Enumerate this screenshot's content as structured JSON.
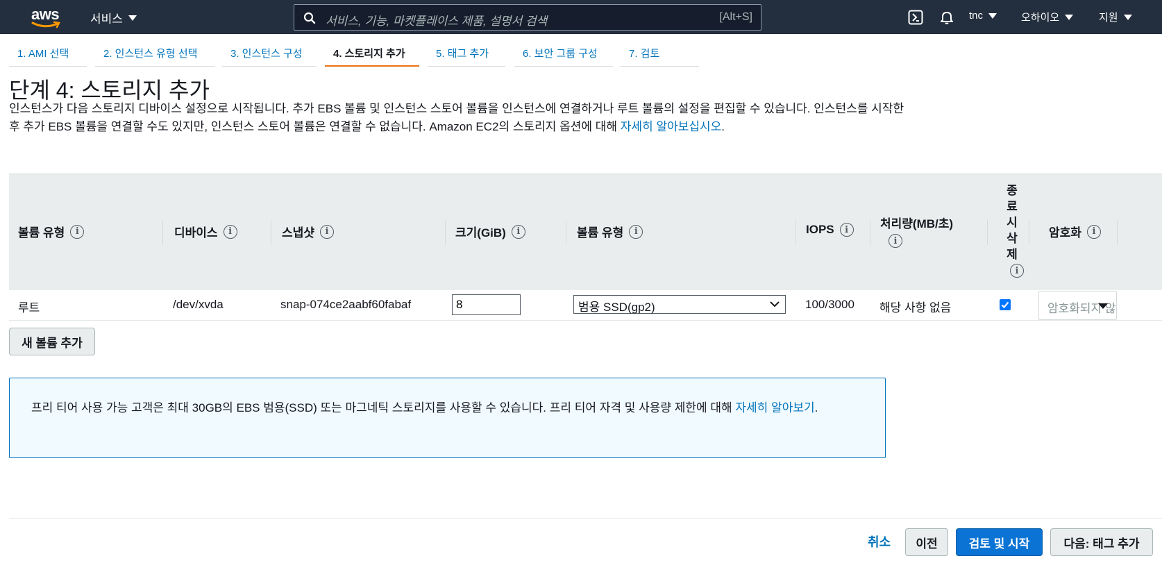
{
  "topnav": {
    "logo_text": "aws",
    "services_label": "서비스",
    "search_placeholder": "서비스, 기능, 마켓플레이스 제품, 설명서 검색",
    "search_shortcut": "[Alt+S]",
    "account_label": "tnc",
    "region_label": "오하이오",
    "support_label": "지원"
  },
  "tabs": [
    {
      "label": "1. AMI 선택"
    },
    {
      "label": "2. 인스턴스 유형 선택"
    },
    {
      "label": "3. 인스턴스 구성"
    },
    {
      "label": "4. 스토리지 추가"
    },
    {
      "label": "5. 태그 추가"
    },
    {
      "label": "6. 보안 그룹 구성"
    },
    {
      "label": "7. 검토"
    }
  ],
  "page": {
    "title": "단계 4: 스토리지 추가",
    "description": "인스턴스가 다음 스토리지 디바이스 설정으로 시작됩니다. 추가 EBS 볼륨 및 인스턴스 스토어 볼륨을 인스턴스에 연결하거나 루트 볼륨의 설정을 편집할 수 있습니다. 인스턴스를 시작한 후 추가 EBS 볼륨을 연결할 수도 있지만, 인스턴스 스토어 볼륨은 연결할 수 없습니다. Amazon EC2의 스토리지 옵션에 대해 ",
    "description_link": "자세히 알아보십시오",
    "description_end": "."
  },
  "table": {
    "headers": {
      "volume_type": "볼륨 유형",
      "device": "디바이스",
      "snapshot": "스냅샷",
      "size": "크기(GiB)",
      "volume_kind": "볼륨 유형",
      "iops": "IOPS",
      "throughput": "처리량(MB/초)",
      "delete_on_term": "종료 시 삭제",
      "encryption": "암호화"
    },
    "rows": [
      {
        "volume_type": "루트",
        "device": "/dev/xvda",
        "snapshot": "snap-074ce2aabf60fabaf",
        "size": "8",
        "volume_kind": "범용 SSD(gp2)",
        "iops": "100/3000",
        "throughput": "해당 사항 없음",
        "delete_on_term": true,
        "encryption": "암호화되지 않음"
      }
    ]
  },
  "add_volume_button": "새 볼륨 추가",
  "free_tier": {
    "text": "프리 티어 사용 가능 고객은 최대 30GB의 EBS 범용(SSD) 또는 마그네틱 스토리지를 사용할 수 있습니다. 프리 티어 자격 및 사용량 제한에 대해 ",
    "link": "자세히 알아보기",
    "end": "."
  },
  "footer": {
    "cancel": "취소",
    "previous": "이전",
    "review_launch": "검토 및 시작",
    "next": "다음: 태그 추가"
  },
  "colors": {
    "nav_bg": "#232f3e",
    "link": "#0073bb",
    "active_tab_underline": "#ec7211",
    "primary_button": "#0a73d4"
  }
}
